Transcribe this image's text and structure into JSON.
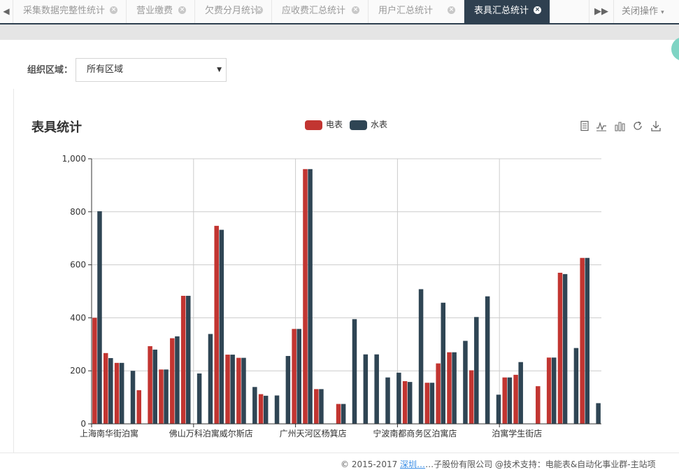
{
  "tabs": [
    {
      "label": "采集数据完整性统计",
      "active": false
    },
    {
      "label": "营业缴费",
      "active": false
    },
    {
      "label": "欠费分月统计",
      "active": false
    },
    {
      "label": "应收费汇总统计",
      "active": false
    },
    {
      "label": "用户汇总统计",
      "active": false
    },
    {
      "label": "表具汇总统计",
      "active": true
    }
  ],
  "tab_close_glyph": "⊗",
  "close_ops_label": "关闭操作",
  "filter": {
    "label": "组织区域：",
    "selected": "所有区域"
  },
  "chart_title": "表具统计",
  "colors": {
    "electric": "#c23531",
    "water": "#2f4554",
    "tab_active": "#2f4050"
  },
  "toolbox": [
    "data-view-icon",
    "line-chart-icon",
    "bar-chart-icon",
    "restore-icon",
    "download-icon"
  ],
  "footer": {
    "prefix": "© 2015-2017 ",
    "link": "深圳…",
    "text": "…子股份有限公司 @技术支持：电能表&自动化事业群-主站项"
  },
  "chart_data": {
    "type": "bar",
    "series": [
      {
        "name": "电表",
        "values": [
          400,
          267,
          230,
          null,
          127,
          293,
          205,
          323,
          483,
          null,
          null,
          747,
          261,
          249,
          null,
          112,
          null,
          null,
          358,
          961,
          131,
          null,
          75,
          null,
          null,
          null,
          null,
          null,
          161,
          null,
          155,
          228,
          270,
          null,
          202,
          null,
          null,
          175,
          185,
          null,
          142,
          250,
          570,
          null,
          626,
          null
        ]
      },
      {
        "name": "水表",
        "values": [
          802,
          248,
          230,
          200,
          null,
          280,
          205,
          330,
          483,
          190,
          339,
          732,
          261,
          249,
          139,
          106,
          107,
          256,
          358,
          961,
          131,
          null,
          75,
          395,
          262,
          262,
          175,
          193,
          158,
          508,
          155,
          457,
          270,
          313,
          403,
          481,
          110,
          175,
          233,
          null,
          null,
          250,
          565,
          286,
          626,
          78
        ]
      }
    ],
    "x_tick_labels": [
      "上海南华街泊寓",
      "佛山万科泊寓威尔斯店",
      "广州天河区杨箕店",
      "宁波南都商务区泊寓店",
      "泊寓学生街店"
    ],
    "ylim": [
      0,
      1000
    ],
    "y_ticks": [
      0,
      200,
      400,
      600,
      800,
      1000
    ],
    "y_tick_labels": [
      "0",
      "200",
      "400",
      "600",
      "800",
      "1,000"
    ],
    "grid": true,
    "legend_position": "top-center"
  }
}
